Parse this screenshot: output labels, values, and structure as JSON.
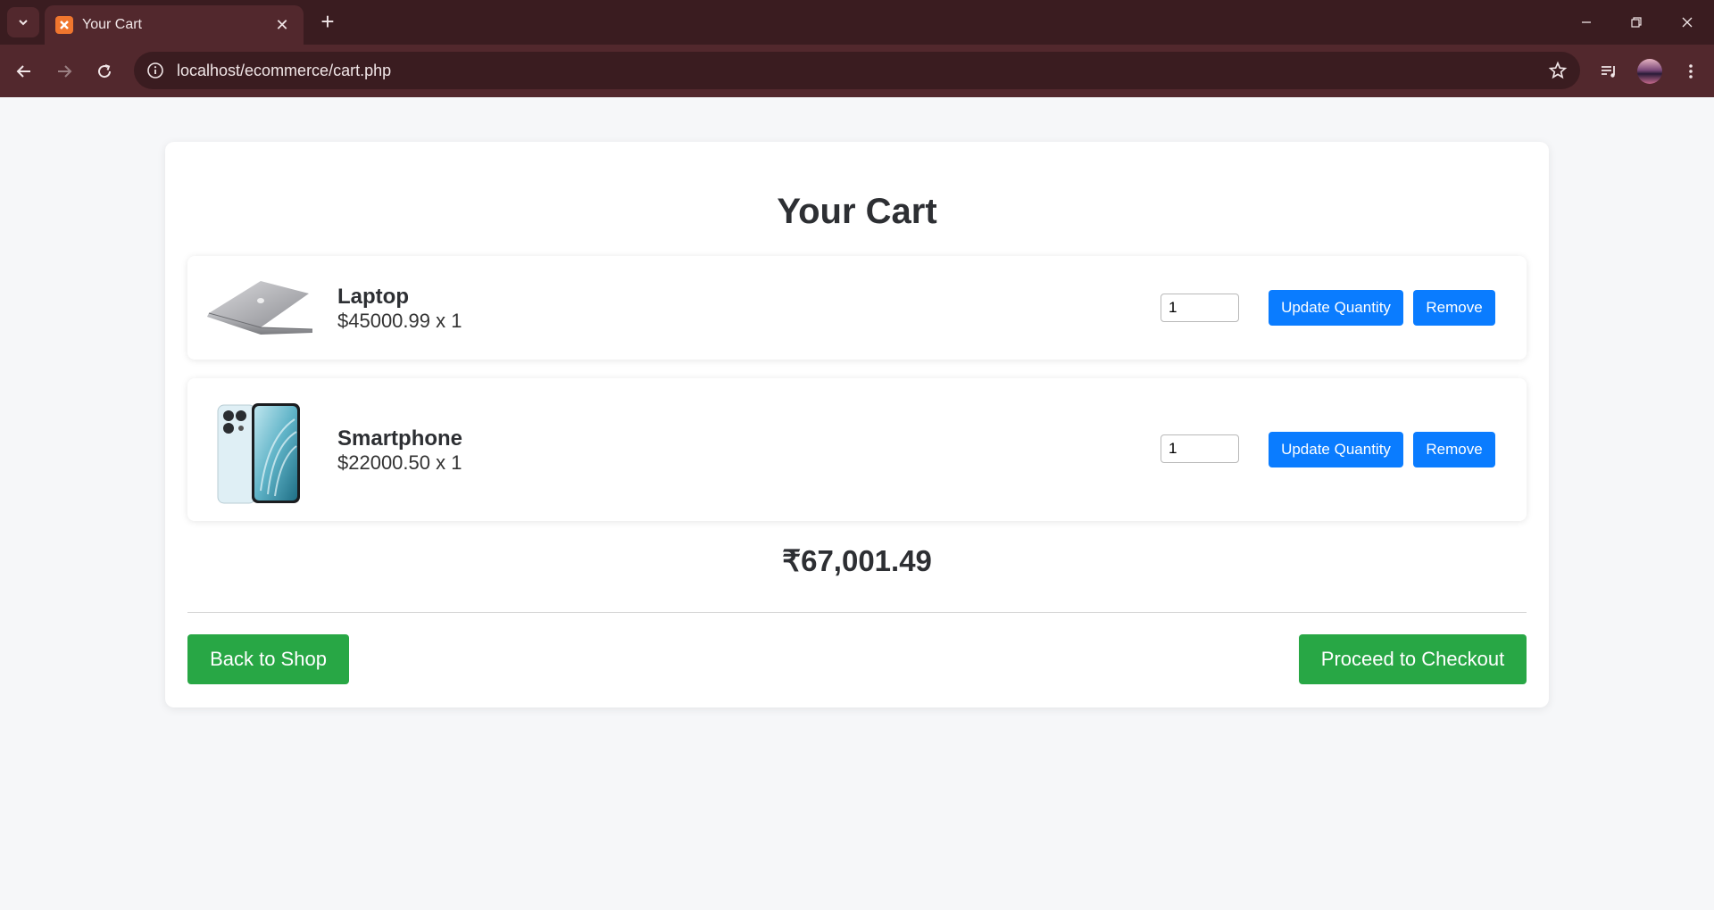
{
  "browser": {
    "tab_title": "Your Cart",
    "url": "localhost/ecommerce/cart.php",
    "new_tab_label": "+",
    "tab_close_label": "✕"
  },
  "page": {
    "title": "Your Cart",
    "items": [
      {
        "name": "Laptop",
        "price_line": "$45000.99 x 1",
        "quantity": "1",
        "update_label": "Update Quantity",
        "remove_label": "Remove"
      },
      {
        "name": "Smartphone",
        "price_line": "$22000.50 x 1",
        "quantity": "1",
        "update_label": "Update Quantity",
        "remove_label": "Remove"
      }
    ],
    "total": "₹67,001.49",
    "back_label": "Back to Shop",
    "checkout_label": "Proceed to Checkout"
  },
  "colors": {
    "primary_blue": "#0a7cff",
    "success_green": "#28a745",
    "chrome_dark": "#3a1c20",
    "chrome_toolbar": "#52282d"
  },
  "icons": [
    "chevron-down-icon",
    "xampp-favicon",
    "close-icon",
    "plus-icon",
    "minimize-icon",
    "restore-icon",
    "back-icon",
    "forward-icon",
    "reload-icon",
    "info-icon",
    "star-icon",
    "media-control-icon",
    "avatar",
    "more-vert-icon"
  ]
}
